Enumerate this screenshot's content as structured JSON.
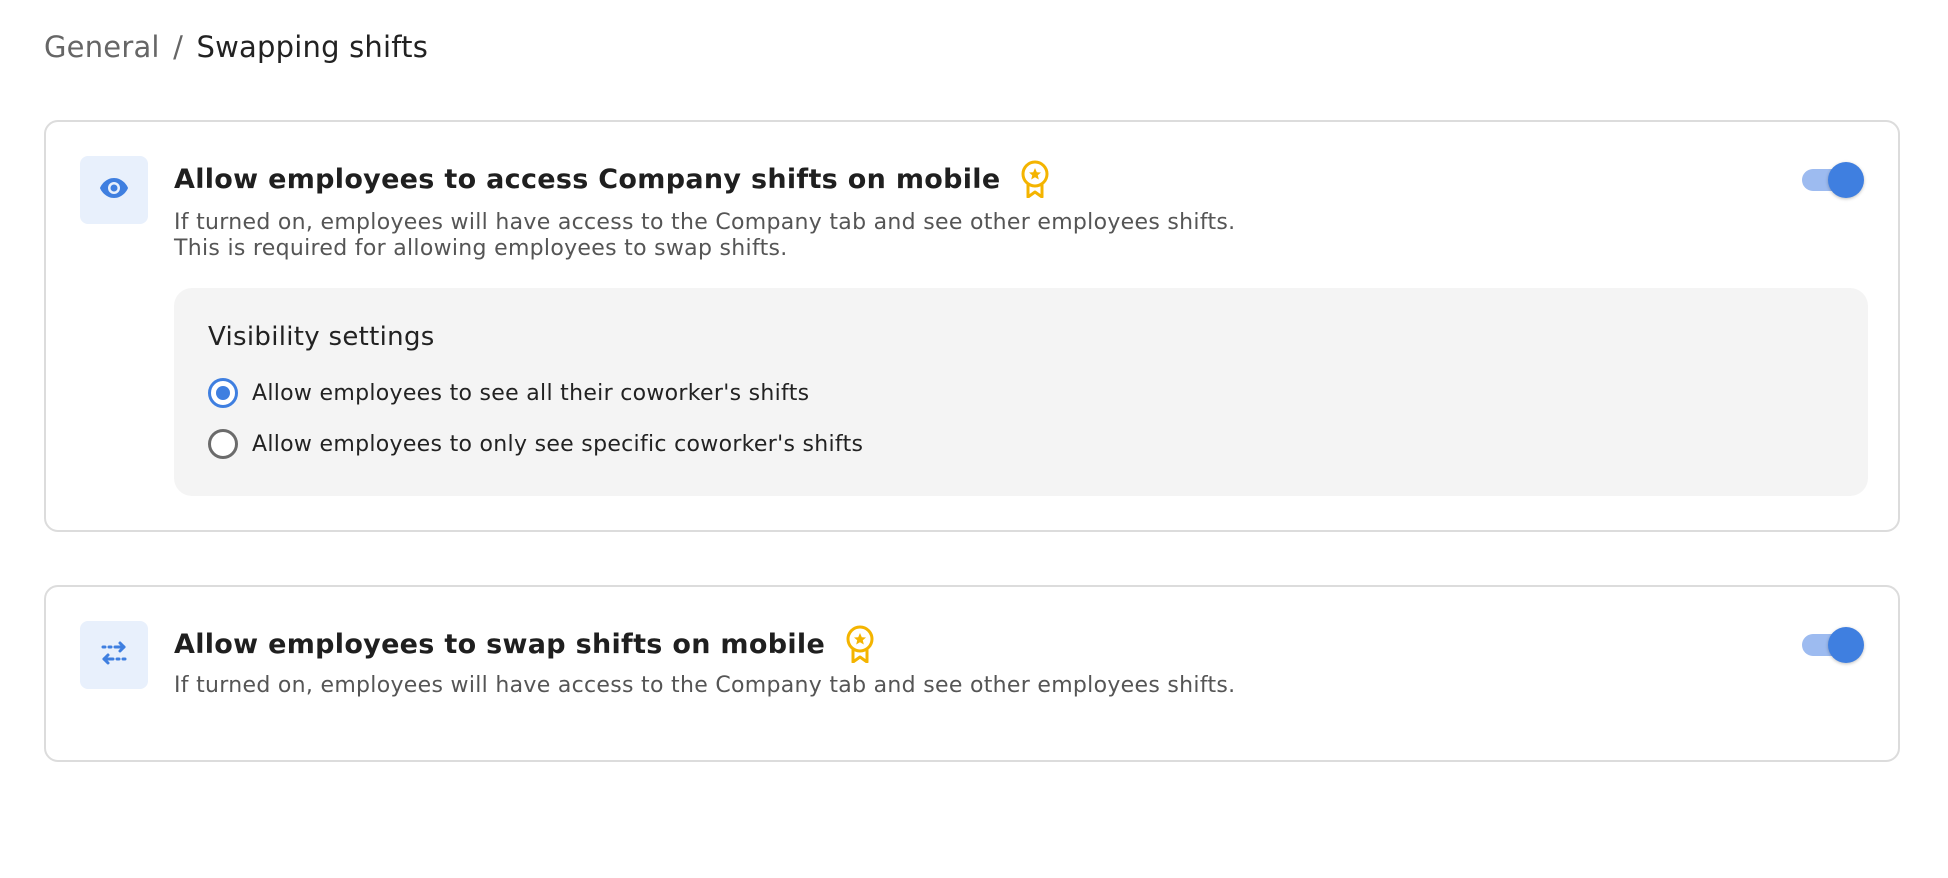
{
  "breadcrumb": {
    "parent": "General",
    "separator": "/",
    "current": "Swapping shifts"
  },
  "colors": {
    "accent": "#3f7fe0",
    "premium": "#f4b400",
    "icon_tile_bg": "#e8f0fc",
    "panel_bg": "#f4f4f4"
  },
  "settings": [
    {
      "icon": "eye-icon",
      "title": "Allow employees to access Company shifts on mobile",
      "premium_badge": "premium-badge-icon",
      "description_line1": "If turned on, employees will have access to the Company tab and see other employees shifts.",
      "description_line2": "This is required for allowing employees to swap shifts.",
      "enabled": true,
      "visibility": {
        "title": "Visibility settings",
        "options": [
          {
            "label": "Allow employees to see all their coworker's shifts",
            "selected": true
          },
          {
            "label": "Allow employees to only see specific coworker's shifts",
            "selected": false
          }
        ]
      }
    },
    {
      "icon": "swap-arrows-icon",
      "title": "Allow employees to swap shifts on mobile",
      "premium_badge": "premium-badge-icon",
      "description_line1": "If turned on, employees will have access to the Company tab and see other employees shifts.",
      "enabled": true
    }
  ]
}
